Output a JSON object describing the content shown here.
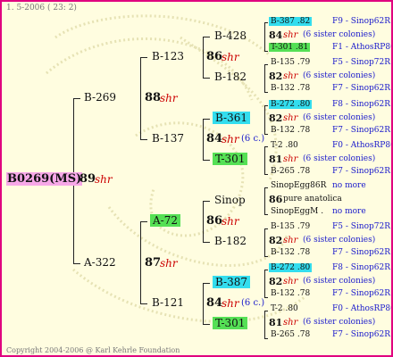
{
  "header": "1.  5-2006 ( 23:  2)",
  "footer": "Copyright 2004-2006 @ Karl Kehrle Foundation",
  "root": {
    "id": "B0269(MS)",
    "num": "89",
    "shr": "shr"
  },
  "gen1": [
    {
      "id": "B-269",
      "num": "88",
      "shr": "shr"
    },
    {
      "id": "A-322",
      "num": "87",
      "shr": "shr"
    }
  ],
  "gen2": [
    {
      "id": "B-123",
      "num": "86",
      "shr": "shr"
    },
    {
      "id": "B-137",
      "num": "84",
      "shr": "shr",
      "note": "(6 c.)"
    },
    {
      "id": "A-72",
      "num": "86",
      "shr": "shr"
    },
    {
      "id": "B-121",
      "num": "84",
      "shr": "shr",
      "note": "(6 c.)"
    }
  ],
  "gen3": [
    "B-428",
    "B-182",
    "B-361",
    "T-301",
    "Sinop",
    "B-182",
    "B-387",
    "T-301"
  ],
  "groups": [
    {
      "top": "B-387 .82",
      "topr": "F9 - Sinop62R",
      "num": "84",
      "shr": "shr",
      "note": "(6 sister colonies)",
      "bot": "T-301 .81",
      "botr": "F1 - AthosRP80R"
    },
    {
      "top": "B-135 .79",
      "topr": "F5 - Sinop72R",
      "num": "82",
      "shr": "shr",
      "note": "(6 sister colonies)",
      "bot": "B-132 .78",
      "botr": "F7 - Sinop62R"
    },
    {
      "top": "B-272 .80",
      "topr": "F8 - Sinop62R",
      "num": "82",
      "shr": "shr",
      "note": "(6 sister colonies)",
      "bot": "B-132 .78",
      "botr": "F7 - Sinop62R"
    },
    {
      "top": "T-2 .80",
      "topr": "F0 - AthosRP80R",
      "num": "81",
      "shr": "shr",
      "note": "(6 sister colonies)",
      "bot": "B-265 .78",
      "botr": "F7 - Sinop62R"
    },
    {
      "top": "SinopEgg86R",
      "topr": "no more",
      "num": "86",
      "shr": "",
      "note": "pure anatolica",
      "bot": "SinopEggM .",
      "botr": "no more"
    },
    {
      "top": "B-135 .79",
      "topr": "F5 - Sinop72R",
      "num": "82",
      "shr": "shr",
      "note": "(6 sister colonies)",
      "bot": "B-132 .78",
      "botr": "F7 - Sinop62R"
    },
    {
      "top": "B-272 .80",
      "topr": "F8 - Sinop62R",
      "num": "82",
      "shr": "shr",
      "note": "(6 sister colonies)",
      "bot": "B-132 .78",
      "botr": "F7 - Sinop62R"
    },
    {
      "top": "T-2 .80",
      "topr": "F0 - AthosRP80R",
      "num": "81",
      "shr": "shr",
      "note": "(6 sister colonies)",
      "bot": "B-265 .78",
      "botr": "F7 - Sinop62R"
    }
  ],
  "colors": {
    "border": "#e0007f",
    "background": "#fffde0",
    "root_highlight": "#f7a8e8",
    "cyan": "#33ddee",
    "green": "#55e055",
    "shr": "#cc0000",
    "blue_text": "#1a1acc"
  }
}
